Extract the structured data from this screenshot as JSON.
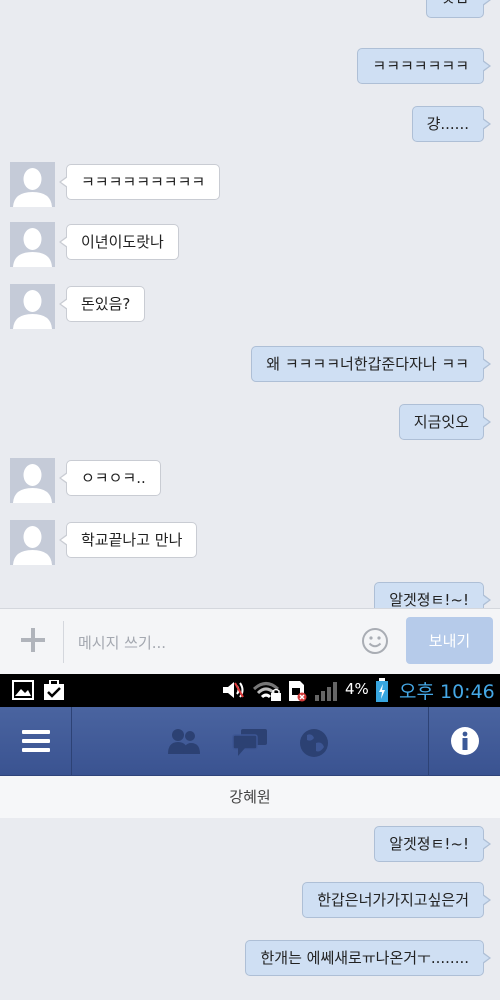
{
  "conversation_top": {
    "messages": [
      {
        "dir": "out",
        "text": "ㅅㅂ"
      },
      {
        "dir": "out",
        "text": "ㅋㅋㅋㅋㅋㅋㅋ"
      },
      {
        "dir": "out",
        "text": "걍......"
      },
      {
        "dir": "in",
        "text": "ㅋㅋㅋㅋㅋㅋㅋㅋㅋ"
      },
      {
        "dir": "in",
        "text": "이년이도랏나"
      },
      {
        "dir": "in",
        "text": "돈있음?"
      },
      {
        "dir": "out",
        "text": "왜 ㅋㅋㅋㅋ너한갑준다자나 ㅋㅋ"
      },
      {
        "dir": "out",
        "text": "지금잇오"
      },
      {
        "dir": "in",
        "text": "ㅇㅋㅇㅋ.."
      },
      {
        "dir": "in",
        "text": "학교끝나고 만나"
      },
      {
        "dir": "out",
        "text": "알겟졍ㅌ!~!"
      }
    ]
  },
  "composer": {
    "placeholder": "메시지 쓰기...",
    "send_label": "보내기",
    "plus_icon": "plus-icon",
    "emoji_icon": "smiley-icon"
  },
  "status_bar": {
    "battery_percent": "4%",
    "time": "오후 10:46",
    "time_color": "#45a8e6",
    "icons": [
      "gallery-icon",
      "task-icon",
      "volume-icon",
      "wifi-lock-icon",
      "sim-icon",
      "signal-icon",
      "battery-icon"
    ]
  },
  "nav": {
    "color": "#3b5998",
    "icons": [
      "menu-icon",
      "friends-icon",
      "messages-icon",
      "globe-icon",
      "info-icon"
    ]
  },
  "chat_title": "강혜원",
  "conversation_bottom": {
    "messages": [
      {
        "dir": "out",
        "text": "알겟졍ㅌ!~!"
      },
      {
        "dir": "out",
        "text": "한갑은너가가지고싶은거"
      },
      {
        "dir": "out",
        "text": "한개는 에쎄새로ㅠ나온거ㅜ........"
      }
    ]
  }
}
